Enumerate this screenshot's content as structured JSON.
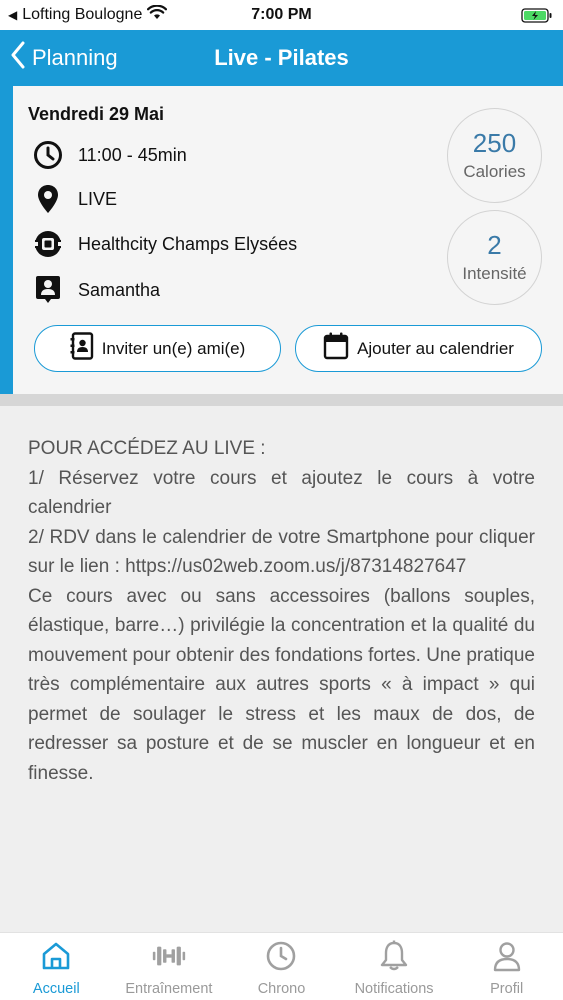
{
  "status_bar": {
    "carrier": "Lofting Boulogne",
    "time": "7:00 PM"
  },
  "nav": {
    "back_label": "Planning",
    "title": "Live - Pilates"
  },
  "session": {
    "date": "Vendredi 29 Mai",
    "time": "11:00 - 45min",
    "mode": "LIVE",
    "club": "Healthcity Champs Elysées",
    "coach": "Samantha",
    "calories_value": "250",
    "calories_label": "Calories",
    "intensity_value": "2",
    "intensity_label": "Intensité",
    "invite_label": "Inviter un(e) ami(e)",
    "calendar_label": "Ajouter au calendrier"
  },
  "description": {
    "lines": [
      "POUR ACCÉDEZ AU LIVE :",
      "1/ Réservez votre cours et ajoutez le cours à votre calendrier",
      "2/ RDV dans le calendrier de votre Smartphone pour cliquer sur le lien : https://us02web.zoom.us/j/87314827647",
      "Ce cours avec ou sans accessoires (ballons souples, élastique, barre…) privilégie la concentration et la qualité du mouvement pour obtenir des fondations fortes. Une pratique très complémentaire aux autres sports « à impact » qui permet de soulager le stress et les maux de dos, de redresser sa posture et de se muscler en longueur et en finesse."
    ]
  },
  "tabs": [
    {
      "label": "Accueil",
      "icon": "home-icon",
      "active": true
    },
    {
      "label": "Entraînement",
      "icon": "dumbbell-icon",
      "active": false
    },
    {
      "label": "Chrono",
      "icon": "clock-icon",
      "active": false
    },
    {
      "label": "Notifications",
      "icon": "bell-icon",
      "active": false
    },
    {
      "label": "Profil",
      "icon": "user-icon",
      "active": false
    }
  ],
  "colors": {
    "accent": "#1a9ad6",
    "stat_value": "#3a7aa8",
    "inactive_tab": "#9a9a9a"
  }
}
